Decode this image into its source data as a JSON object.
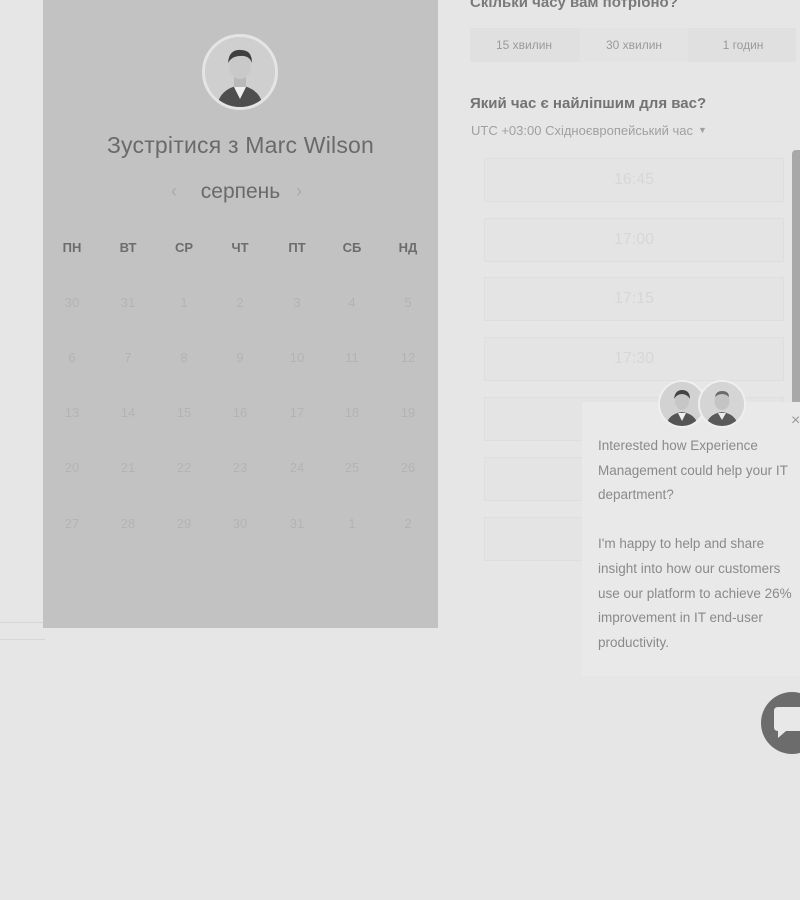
{
  "booking": {
    "title": "Зустрітися з Marc Wilson",
    "month": "серпень",
    "prev_arrow": "‹",
    "next_arrow": "›",
    "weekdays": [
      "ПН",
      "ВТ",
      "СР",
      "ЧТ",
      "ПТ",
      "СБ",
      "НД"
    ],
    "weeks": [
      [
        "30",
        "31",
        "1",
        "2",
        "3",
        "4",
        "5"
      ],
      [
        "6",
        "7",
        "8",
        "9",
        "10",
        "11",
        "12"
      ],
      [
        "13",
        "14",
        "15",
        "16",
        "17",
        "18",
        "19"
      ],
      [
        "20",
        "21",
        "22",
        "23",
        "24",
        "25",
        "26"
      ],
      [
        "27",
        "28",
        "29",
        "30",
        "31",
        "1",
        "2"
      ]
    ]
  },
  "duration": {
    "question": "Скільки часу вам потрібно?",
    "options": [
      "15 хвилин",
      "30 хвилин",
      "1 годин"
    ],
    "selected": "30 хвилин"
  },
  "time": {
    "question": "Який час є найліпшим для вас?",
    "timezone": "UTC +03:00 Східноєвропейський час",
    "slots": [
      "16:45",
      "17:00",
      "17:15",
      "17:30"
    ]
  },
  "chat": {
    "close": "×",
    "message_1": "Interested how Experience Management could help your IT department?",
    "message_2": "I'm happy to help and share insight into how our customers use our platform to achieve 26% improvement in IT end-user productivity."
  },
  "icons": {
    "prev": "chevron-left-icon",
    "next": "chevron-right-icon",
    "caret": "caret-down-icon",
    "launcher": "chat-bubble-icon"
  }
}
